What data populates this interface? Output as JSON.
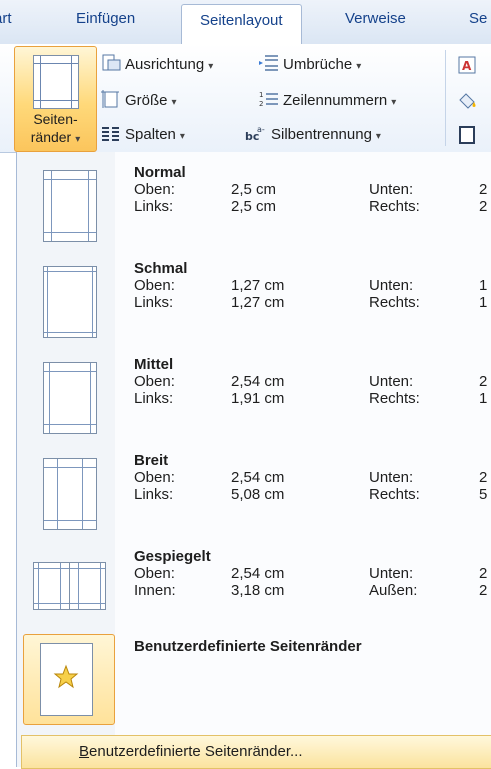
{
  "tabs": [
    {
      "label": "art"
    },
    {
      "label": "Einfügen"
    },
    {
      "label": "Seitenlayout"
    },
    {
      "label": "Verweise"
    },
    {
      "label": "Se"
    }
  ],
  "ribbon": {
    "margins_button": {
      "line1": "Seiten-",
      "line2": "ränder"
    },
    "orientation": "Ausrichtung",
    "size": "Größe",
    "columns": "Spalten",
    "breaks": "Umbrüche",
    "line_numbers": "Zeilennummern",
    "hyphenation": "Silbentrennung"
  },
  "margin_options": [
    {
      "name": "Normal",
      "k1": "Oben:",
      "v1": "2,5  cm",
      "k2": "Unten:",
      "v2": "2",
      "k3": "Links:",
      "v3": "2,5  cm",
      "k4": "Rechts:",
      "v4": "2"
    },
    {
      "name": "Schmal",
      "k1": "Oben:",
      "v1": "1,27  cm",
      "k2": "Unten:",
      "v2": "1",
      "k3": "Links:",
      "v3": "1,27  cm",
      "k4": "Rechts:",
      "v4": "1"
    },
    {
      "name": "Mittel",
      "k1": "Oben:",
      "v1": "2,54  cm",
      "k2": "Unten:",
      "v2": "2",
      "k3": "Links:",
      "v3": "1,91  cm",
      "k4": "Rechts:",
      "v4": "1"
    },
    {
      "name": "Breit",
      "k1": "Oben:",
      "v1": "2,54  cm",
      "k2": "Unten:",
      "v2": "2",
      "k3": "Links:",
      "v3": "5,08  cm",
      "k4": "Rechts:",
      "v4": "5"
    },
    {
      "name": "Gespiegelt",
      "k1": "Oben:",
      "v1": "2,54  cm",
      "k2": "Unten:",
      "v2": "2",
      "k3": "Innen:",
      "v3": "3,18  cm",
      "k4": "Außen:",
      "v4": "2"
    }
  ],
  "custom_option": {
    "name": "Benutzerdefinierte Seitenränder"
  },
  "footer": {
    "first": "B",
    "rest": "enutzerdefinierte Seitenränder..."
  }
}
